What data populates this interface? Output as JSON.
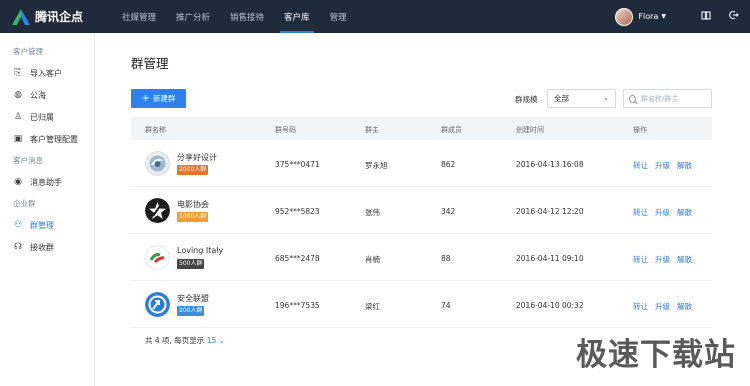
{
  "brand": {
    "name": "腾讯企点"
  },
  "nav": [
    {
      "label": "社媒管理"
    },
    {
      "label": "推广分析"
    },
    {
      "label": "销售接待"
    },
    {
      "label": "客户库",
      "active": true
    },
    {
      "label": "管理"
    }
  ],
  "user": {
    "name": "Flora"
  },
  "sidebar": {
    "groups": [
      {
        "title": "客户管理",
        "items": [
          {
            "label": "导入客户",
            "icon": "import-icon"
          },
          {
            "label": "公海",
            "icon": "globe-icon"
          },
          {
            "label": "已归属",
            "icon": "user-icon"
          },
          {
            "label": "客户管理配置",
            "icon": "briefcase-icon"
          }
        ]
      },
      {
        "title": "客户消息",
        "items": [
          {
            "label": "消息助手",
            "icon": "target-icon"
          }
        ]
      },
      {
        "title": "企业群",
        "items": [
          {
            "label": "群管理",
            "icon": "group-icon",
            "active": true
          },
          {
            "label": "接收群",
            "icon": "headset-icon"
          }
        ]
      }
    ]
  },
  "page": {
    "title": "群管理",
    "new_button": "新建群",
    "filter_label": "群规模",
    "filter_value": "全部",
    "search_placeholder": "群名称/群主"
  },
  "table": {
    "headers": [
      "群名称",
      "群号码",
      "群主",
      "群成员",
      "创建时间",
      "操作"
    ],
    "rows": [
      {
        "name": "分享好设计",
        "badge": "2000人群",
        "badge_color": "#e8742c",
        "number": "375***0471",
        "owner": "罗永旭",
        "members": "862",
        "created": "2016-04-13  16:08",
        "icon": "design-logo"
      },
      {
        "name": "电影协会",
        "badge": "1000人群",
        "badge_color": "#e9a22b",
        "number": "952***5823",
        "owner": "张伟",
        "members": "342",
        "created": "2016-04-12  12:20",
        "icon": "movie-logo"
      },
      {
        "name": "Loving Italy",
        "badge": "500人群",
        "badge_color": "#444444",
        "number": "685***2478",
        "owner": "肖楠",
        "members": "88",
        "created": "2016-04-11  09:10",
        "icon": "italy-logo"
      },
      {
        "name": "安全联盟",
        "badge": "200人群",
        "badge_color": "#3b8de0",
        "number": "196***7535",
        "owner": "梁红",
        "members": "74",
        "created": "2016-04-10  00:32",
        "icon": "security-logo"
      }
    ],
    "actions": [
      "转让",
      "升级",
      "解散"
    ]
  },
  "pager": {
    "summary": "共 4 项, 每页显示",
    "page_size": "15"
  },
  "watermark": "极速下载站"
}
